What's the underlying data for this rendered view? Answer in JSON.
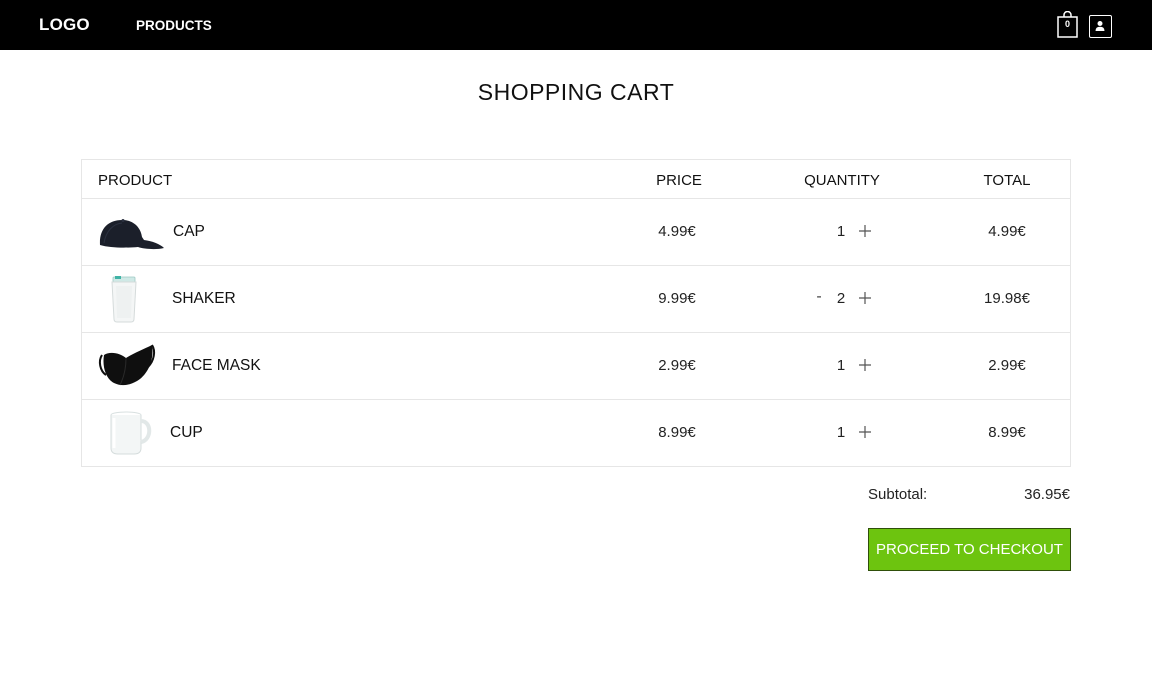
{
  "colors": {
    "navbar_bg": "#000000",
    "checkout_bg": "#6dc40f",
    "border": "#e6e6e6"
  },
  "nav": {
    "logo": "LOGO",
    "products_link": "PRODUCTS",
    "cart_count": "0",
    "cart_icon": "shopping-bag-icon",
    "user_icon": "user-icon"
  },
  "page": {
    "title": "SHOPPING CART"
  },
  "table": {
    "headers": {
      "product": "PRODUCT",
      "price": "PRICE",
      "quantity": "QUANTITY",
      "total": "TOTAL"
    },
    "rows": [
      {
        "name": "CAP",
        "image": "cap-image",
        "price": "4.99€",
        "quantity": "1",
        "show_minus": false,
        "minus": "",
        "total": "4.99€"
      },
      {
        "name": "SHAKER",
        "image": "shaker-image",
        "price": "9.99€",
        "quantity": "2",
        "show_minus": true,
        "minus": "-",
        "total": "19.98€"
      },
      {
        "name": "FACE MASK",
        "image": "face-mask-image",
        "price": "2.99€",
        "quantity": "1",
        "show_minus": false,
        "minus": "",
        "total": "2.99€"
      },
      {
        "name": "CUP",
        "image": "cup-image",
        "price": "8.99€",
        "quantity": "1",
        "show_minus": false,
        "minus": "",
        "total": "8.99€"
      }
    ]
  },
  "summary": {
    "subtotal_label": "Subtotal:",
    "subtotal_value": "36.95€",
    "checkout_label": "PROCEED TO CHECKOUT"
  }
}
